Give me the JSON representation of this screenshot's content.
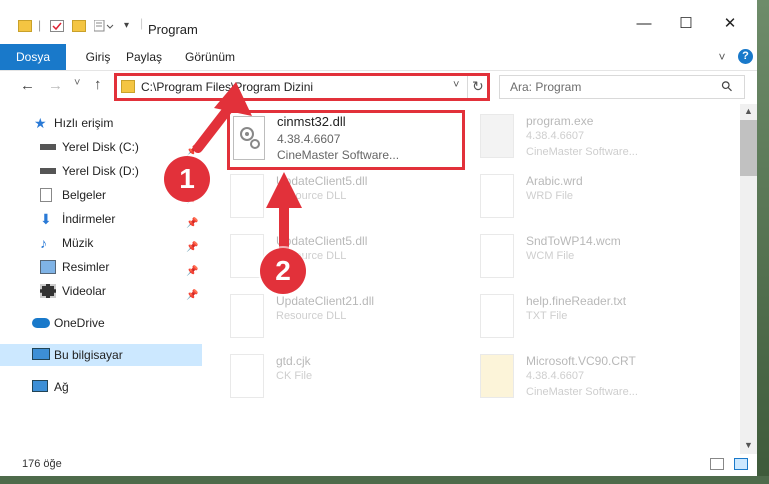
{
  "window": {
    "title": "Program",
    "minimize_glyph": "—",
    "maximize_glyph": "☐",
    "close_glyph": "✕"
  },
  "ribbon": {
    "tabs": [
      "Dosya",
      "Giriş",
      "Paylaş",
      "Görünüm"
    ],
    "expand_glyph": "˅",
    "help_glyph": "?"
  },
  "navigation": {
    "back_glyph": "←",
    "forward_glyph": "→",
    "recent_glyph": "˅",
    "up_glyph": "↑"
  },
  "address_bar": {
    "path": "C:\\Program Files\\Program Dizini",
    "dropdown_glyph": "˅",
    "refresh_glyph": "↻"
  },
  "search": {
    "placeholder": "Ara: Program",
    "icon_glyph": "⚲"
  },
  "sidebar": {
    "quick_access": "Hızlı erişim",
    "items": [
      {
        "label": "Yerel Disk (C:)",
        "icon": "drive-icon",
        "pinned": true
      },
      {
        "label": "Yerel Disk (D:)",
        "icon": "drive-icon",
        "pinned": false
      },
      {
        "label": "Belgeler",
        "icon": "documents-icon",
        "pinned": true
      },
      {
        "label": "İndirmeler",
        "icon": "download-icon",
        "pinned": true
      },
      {
        "label": "Müzik",
        "icon": "music-icon",
        "pinned": true
      },
      {
        "label": "Resimler",
        "icon": "pictures-icon",
        "pinned": true
      },
      {
        "label": "Videolar",
        "icon": "videos-icon",
        "pinned": true
      }
    ],
    "onedrive": "OneDrive",
    "this_pc": "Bu bilgisayar",
    "network": "Ağ",
    "pin_glyph": "📌"
  },
  "files": {
    "left": [
      {
        "name": "cinmst32.dll",
        "line2": "4.38.4.6607",
        "line3": "CineMaster Software..."
      },
      {
        "name": "UpdateClient5.dll",
        "line2": "Resource DLL",
        "line3": ""
      },
      {
        "name": "UpdateClient5.dll",
        "line2": "Resource DLL",
        "line3": ""
      },
      {
        "name": "UpdateClient21.dll",
        "line2": "Resource DLL",
        "line3": ""
      },
      {
        "name": "gtd.cjk",
        "line2": "CK File",
        "line3": ""
      }
    ],
    "right": [
      {
        "name": "program.exe",
        "line2": "4.38.4.6607",
        "line3": "CineMaster Software..."
      },
      {
        "name": "Arabic.wrd",
        "line2": "WRD File",
        "line3": ""
      },
      {
        "name": "SndToWP14.wcm",
        "line2": "WCM File",
        "line3": ""
      },
      {
        "name": "help.fineReader.txt",
        "line2": "TXT File",
        "line3": ""
      },
      {
        "name": "Microsoft.VC90.CRT",
        "line2": "4.38.4.6607",
        "line3": "CineMaster Software..."
      }
    ]
  },
  "annotations": {
    "badge1": "1",
    "badge2": "2",
    "accent": "#e2313a"
  },
  "status": {
    "item_count": "176 öğe"
  }
}
